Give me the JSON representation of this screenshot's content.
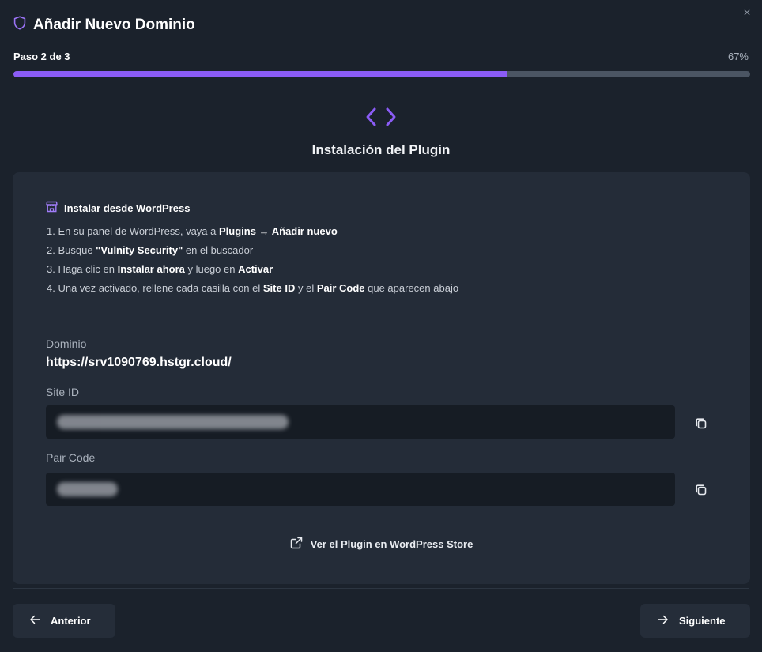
{
  "modal": {
    "title": "Añadir Nuevo Dominio",
    "close_glyph": "×",
    "accent_color": "#8b5cf6",
    "icons": {
      "header": "shield-icon",
      "section": "code-brackets-icon",
      "instructions": "store-icon",
      "copy": "copy-icon",
      "external": "external-link-icon",
      "prev": "arrow-left-icon",
      "next": "arrow-right-icon"
    }
  },
  "progress": {
    "step_label": "Paso 2 de 3",
    "percent_label": "67%",
    "percent_value": 67
  },
  "section": {
    "title": "Instalación del Plugin"
  },
  "instructions": {
    "title": "Instalar desde WordPress",
    "steps": [
      [
        {
          "t": "1. En su panel de WordPress, vaya a "
        },
        {
          "t": "Plugins → Añadir nuevo",
          "b": true
        }
      ],
      [
        {
          "t": "2. Busque "
        },
        {
          "t": "\"Vulnity Security\"",
          "b": true
        },
        {
          "t": " en el buscador"
        }
      ],
      [
        {
          "t": "3. Haga clic en "
        },
        {
          "t": "Instalar ahora",
          "b": true
        },
        {
          "t": " y luego en "
        },
        {
          "t": "Activar",
          "b": true
        }
      ],
      [
        {
          "t": "4. Una vez activado, rellene cada casilla con el "
        },
        {
          "t": "Site ID",
          "b": true
        },
        {
          "t": " y el "
        },
        {
          "t": "Pair Code",
          "b": true
        },
        {
          "t": " que aparecen abajo"
        }
      ]
    ]
  },
  "fields": {
    "domain": {
      "label": "Dominio",
      "value": "https://srv1090769.hstgr.cloud/"
    },
    "site_id": {
      "label": "Site ID"
    },
    "pair_code": {
      "label": "Pair Code"
    }
  },
  "store_link": {
    "label": "Ver el Plugin en WordPress Store"
  },
  "footer": {
    "prev_label": "Anterior",
    "next_label": "Siguiente"
  }
}
